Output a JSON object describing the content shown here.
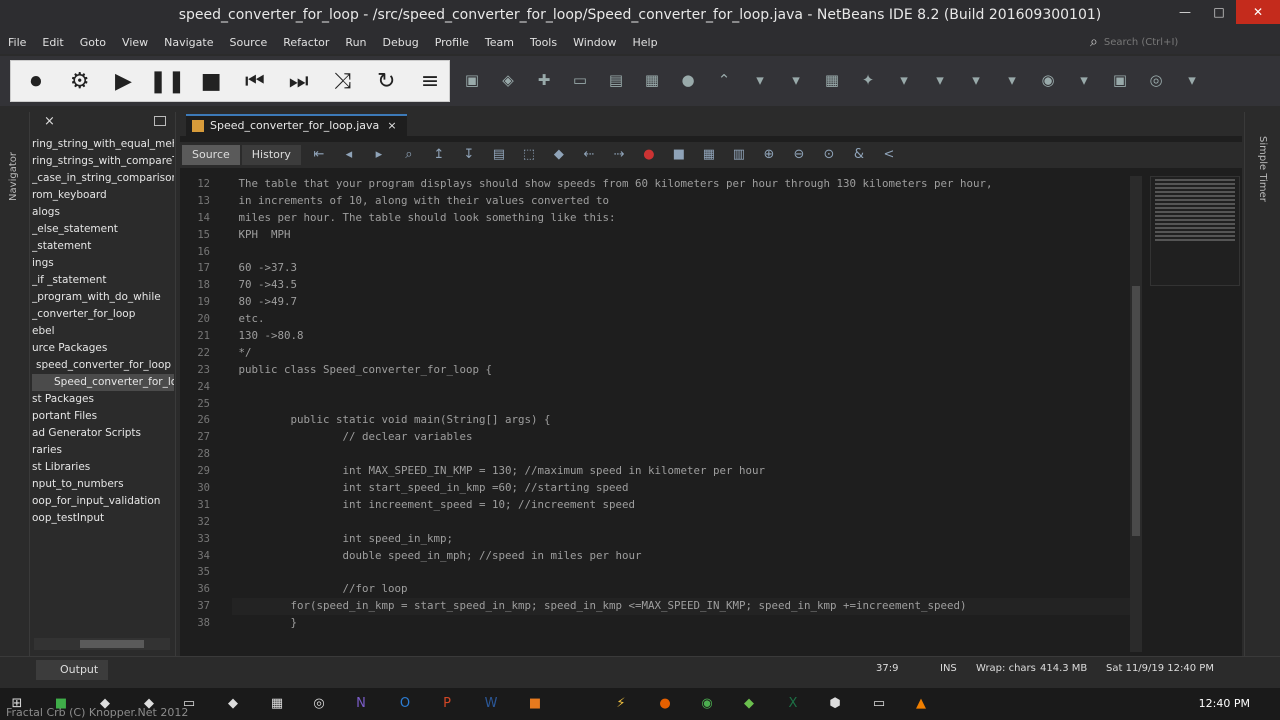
{
  "window": {
    "title": "speed_converter_for_loop - /src/speed_converter_for_loop/Speed_converter_for_loop.java - NetBeans IDE 8.2 (Build 201609300101)",
    "controls": [
      "—",
      "□",
      "✕"
    ]
  },
  "menu": [
    "File",
    "Edit",
    "Goto",
    "View",
    "Navigate",
    "Source",
    "Refactor",
    "Run",
    "Debug",
    "Profile",
    "Team",
    "Tools",
    "Window",
    "Help"
  ],
  "search": {
    "placeholder": "Search (Ctrl+I)"
  },
  "player": {
    "buttons": [
      "⏺",
      "⚙",
      "▶",
      "❚❚",
      "■",
      "⏮",
      "⏭",
      "⤨",
      "↻",
      "≡"
    ]
  },
  "toolbar_icons": [
    "▣",
    "◈",
    "✚",
    "▭",
    "▤",
    "▦",
    "●",
    "⌃",
    "▾",
    "▾",
    "▦",
    "✦",
    "▾",
    "▾",
    "▾",
    "▾",
    "◉",
    "▾",
    "▣",
    "◎",
    "▾"
  ],
  "sidebar": {
    "nav_label": "Navigator",
    "items": [
      "ring_string_with_equal_mehtod",
      "ring_strings_with_compareTo",
      "_case_in_string_comparison",
      "rom_keyboard",
      "alogs",
      "_else_statement",
      "_statement",
      "ings",
      "_if _statement",
      "_program_with_do_while",
      "_converter_for_loop",
      "ebel",
      "urce Packages",
      "speed_converter_for_loop",
      "Speed_converter_for_loo",
      "st Packages",
      "portant Files",
      "ad Generator Scripts",
      "raries",
      "st Libraries",
      "nput_to_numbers",
      "oop_for_input_validation",
      "oop_testInput"
    ],
    "selected_index": 14
  },
  "editor": {
    "tab_label": "Speed_converter_for_loop.java",
    "tab_close": "×",
    "source_label": "Source",
    "history_label": "History",
    "line_numbers": [
      "12",
      "13",
      "14",
      "15",
      "16",
      "17",
      "18",
      "19",
      "20",
      "21",
      "22",
      "23",
      "24",
      "25",
      "26",
      "27",
      "28",
      "29",
      "30",
      "31",
      "32",
      "33",
      "34",
      "35",
      "36",
      "37",
      "38"
    ],
    "lines": [
      " The table that your program displays should show speeds from 60 kilometers per hour through 130 kilometers per hour,",
      " in increments of 10, along with their values converted to",
      " miles per hour. The table should look something like this:",
      " KPH  MPH",
      "",
      " 60 ->37.3",
      " 70 ->43.5",
      " 80 ->49.7",
      " etc.",
      " 130 ->80.8",
      " */",
      " public class Speed_converter_for_loop {",
      "",
      "",
      "         public static void main(String[] args) {",
      "                 // declear variables",
      "",
      "                 int MAX_SPEED_IN_KMP = 130; //maximum speed in kilometer per hour",
      "                 int start_speed_in_kmp =60; //starting speed",
      "                 int increement_speed = 10; //increement speed",
      "",
      "                 int speed_in_kmp;",
      "                 double speed_in_mph; //speed in miles per hour",
      "",
      "                 //for loop",
      "         for(speed_in_kmp = start_speed_in_kmp; speed_in_kmp <=MAX_SPEED_IN_KMP; speed_in_kmp +=increement_speed)",
      "         }"
    ]
  },
  "right_strip": {
    "label": "Simple Timer"
  },
  "status": {
    "output_label": "Output",
    "position": "37:9",
    "mode": "INS",
    "wrap": "Wrap: chars",
    "memory": "414.3 MB",
    "datetime": "Sat 11/9/19 12:40 PM"
  },
  "taskbar": {
    "clock": "12:40 PM",
    "watermark": "Fractal Crb (C) Knopper.Net 2012"
  }
}
